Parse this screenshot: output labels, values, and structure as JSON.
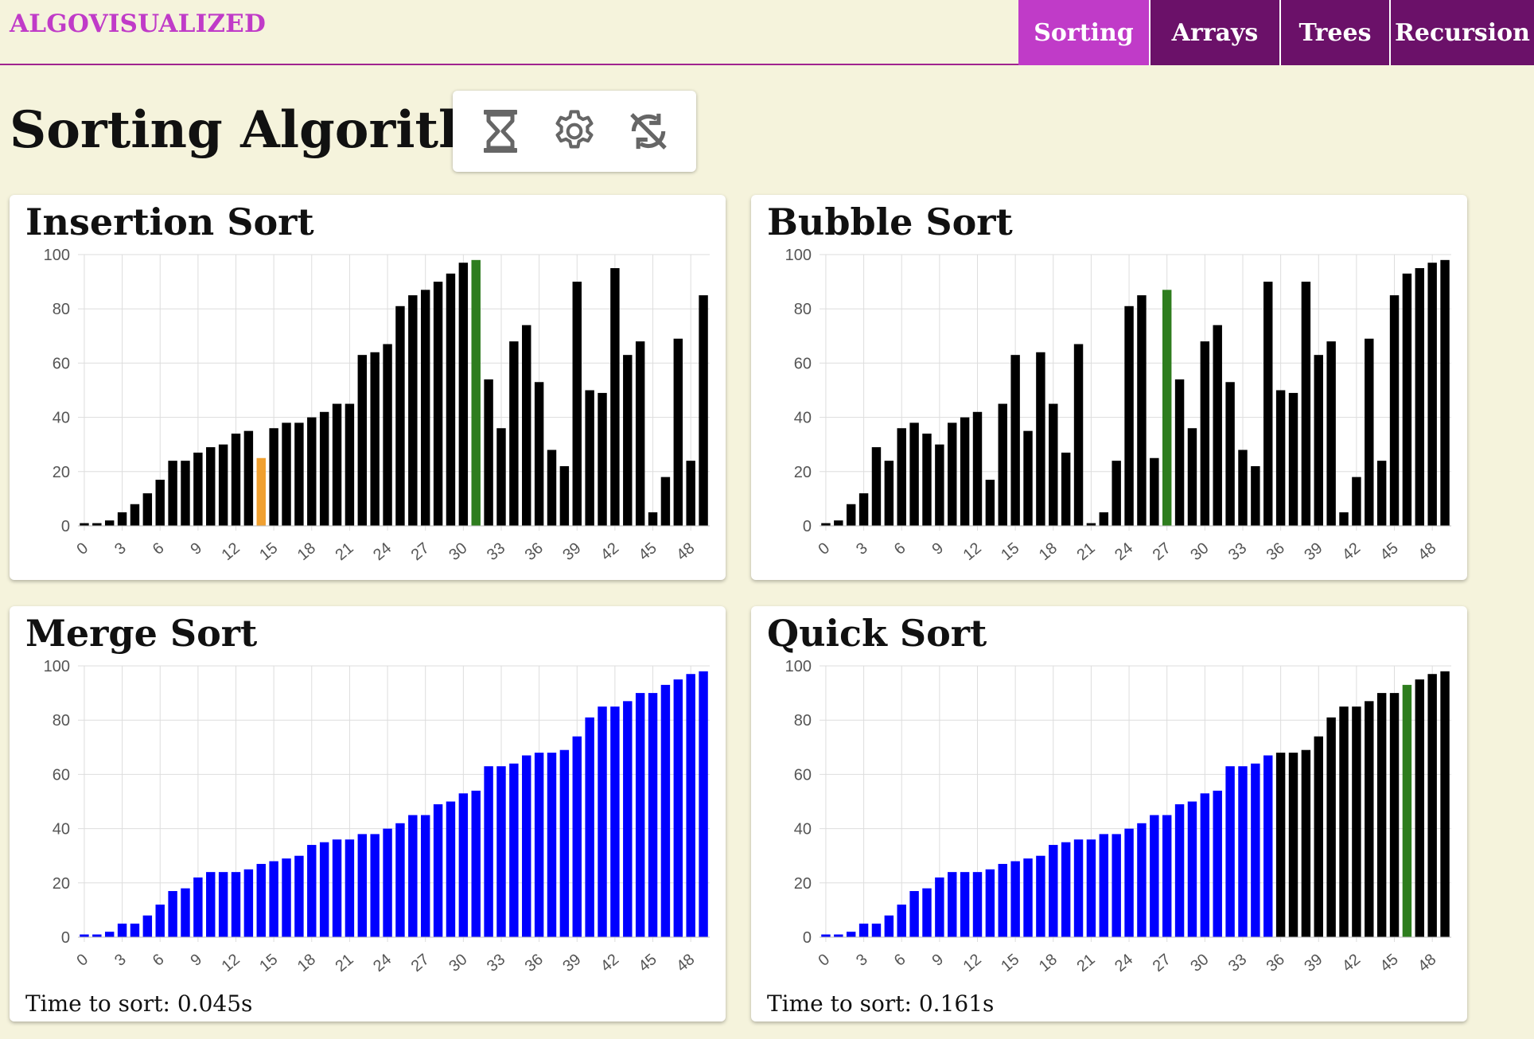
{
  "brand": "ALGOVISUALIZED",
  "nav": {
    "tabs": [
      {
        "label": "Sorting",
        "active": true
      },
      {
        "label": "Arrays",
        "active": false
      },
      {
        "label": "Trees",
        "active": false
      },
      {
        "label": "Recursion",
        "active": false
      }
    ]
  },
  "page": {
    "title": "Sorting Algorithms"
  },
  "toolbar": {
    "buttons": [
      {
        "icon": "hourglass-icon"
      },
      {
        "icon": "gear-icon"
      },
      {
        "icon": "sync-disabled-icon"
      }
    ]
  },
  "colors": {
    "default": "#000000",
    "compare": "#f0a030",
    "current": "#2e7d1e",
    "sorted": "#0000ff",
    "brand": "#c03bc8",
    "tab_active": "#c03bc8",
    "tab_inactive": "#6b1169",
    "background": "#f5f3dc"
  },
  "cards": {
    "insertion": {
      "title": "Insertion Sort"
    },
    "bubble": {
      "title": "Bubble Sort"
    },
    "merge": {
      "title": "Merge Sort",
      "footer": "Time to sort: 0.045s"
    },
    "quick": {
      "title": "Quick Sort",
      "footer": "Time to sort: 0.161s"
    }
  },
  "chart_data": [
    {
      "type": "bar",
      "title": "Insertion Sort",
      "ylim": [
        0,
        100
      ],
      "yticks": [
        0,
        20,
        40,
        60,
        80,
        100
      ],
      "xticks": [
        0,
        3,
        6,
        9,
        12,
        15,
        18,
        21,
        24,
        27,
        30,
        33,
        36,
        39,
        42,
        45,
        48
      ],
      "x": [
        0,
        1,
        2,
        3,
        4,
        5,
        6,
        7,
        8,
        9,
        10,
        11,
        12,
        13,
        14,
        15,
        16,
        17,
        18,
        19,
        20,
        21,
        22,
        23,
        24,
        25,
        26,
        27,
        28,
        29,
        30,
        31,
        32,
        33,
        34,
        35,
        36,
        37,
        38,
        39,
        40,
        41,
        42,
        43,
        44,
        45,
        46,
        47,
        48
      ],
      "values": [
        1,
        1,
        2,
        5,
        8,
        12,
        17,
        24,
        24,
        27,
        29,
        30,
        34,
        35,
        25,
        36,
        38,
        38,
        40,
        42,
        45,
        45,
        63,
        64,
        67,
        81,
        85,
        87,
        90,
        93,
        97,
        98,
        54,
        36,
        68,
        74,
        53,
        28,
        22,
        90,
        50,
        49,
        95,
        63,
        68,
        5,
        18,
        69,
        24,
        85
      ],
      "colors": [
        "default",
        "default",
        "default",
        "default",
        "default",
        "default",
        "default",
        "default",
        "default",
        "default",
        "default",
        "default",
        "default",
        "default",
        "compare",
        "default",
        "default",
        "default",
        "default",
        "default",
        "default",
        "default",
        "default",
        "default",
        "default",
        "default",
        "default",
        "default",
        "default",
        "default",
        "default",
        "current",
        "default",
        "default",
        "default",
        "default",
        "default",
        "default",
        "default",
        "default",
        "default",
        "default",
        "default",
        "default",
        "default",
        "default",
        "default",
        "default",
        "default",
        "default"
      ]
    },
    {
      "type": "bar",
      "title": "Bubble Sort",
      "ylim": [
        0,
        100
      ],
      "yticks": [
        0,
        20,
        40,
        60,
        80,
        100
      ],
      "xticks": [
        0,
        3,
        6,
        9,
        12,
        15,
        18,
        21,
        24,
        27,
        30,
        33,
        36,
        39,
        42,
        45,
        48
      ],
      "values": [
        1,
        2,
        8,
        12,
        29,
        24,
        36,
        38,
        34,
        30,
        38,
        40,
        42,
        17,
        45,
        63,
        35,
        64,
        45,
        27,
        67,
        1,
        5,
        24,
        81,
        85,
        25,
        87,
        54,
        36,
        68,
        74,
        53,
        28,
        22,
        90,
        50,
        49,
        90,
        63,
        68,
        5,
        18,
        69,
        24,
        85,
        93,
        95,
        97,
        98
      ],
      "colors": [
        "default",
        "default",
        "default",
        "default",
        "default",
        "default",
        "default",
        "default",
        "default",
        "default",
        "default",
        "default",
        "default",
        "default",
        "default",
        "default",
        "default",
        "default",
        "default",
        "default",
        "default",
        "default",
        "default",
        "default",
        "default",
        "default",
        "default",
        "current",
        "default",
        "default",
        "default",
        "default",
        "default",
        "default",
        "default",
        "default",
        "default",
        "default",
        "default",
        "default",
        "default",
        "default",
        "default",
        "default",
        "default",
        "default",
        "default",
        "default",
        "default",
        "default"
      ]
    },
    {
      "type": "bar",
      "title": "Merge Sort",
      "ylim": [
        0,
        100
      ],
      "yticks": [
        0,
        20,
        40,
        60,
        80,
        100
      ],
      "xticks": [
        0,
        3,
        6,
        9,
        12,
        15,
        18,
        21,
        24,
        27,
        30,
        33,
        36,
        39,
        42,
        45,
        48
      ],
      "values": [
        1,
        1,
        2,
        5,
        5,
        8,
        12,
        17,
        18,
        22,
        24,
        24,
        24,
        25,
        27,
        28,
        29,
        30,
        34,
        35,
        36,
        36,
        38,
        38,
        40,
        42,
        45,
        45,
        49,
        50,
        53,
        54,
        63,
        63,
        64,
        67,
        68,
        68,
        69,
        74,
        81,
        85,
        85,
        87,
        90,
        90,
        93,
        95,
        97,
        98
      ],
      "colors": [
        "sorted",
        "sorted",
        "sorted",
        "sorted",
        "sorted",
        "sorted",
        "sorted",
        "sorted",
        "sorted",
        "sorted",
        "sorted",
        "sorted",
        "sorted",
        "sorted",
        "sorted",
        "sorted",
        "sorted",
        "sorted",
        "sorted",
        "sorted",
        "sorted",
        "sorted",
        "sorted",
        "sorted",
        "sorted",
        "sorted",
        "sorted",
        "sorted",
        "sorted",
        "sorted",
        "sorted",
        "sorted",
        "sorted",
        "sorted",
        "sorted",
        "sorted",
        "sorted",
        "sorted",
        "sorted",
        "sorted",
        "sorted",
        "sorted",
        "sorted",
        "sorted",
        "sorted",
        "sorted",
        "sorted",
        "sorted",
        "sorted",
        "sorted"
      ]
    },
    {
      "type": "bar",
      "title": "Quick Sort",
      "ylim": [
        0,
        100
      ],
      "yticks": [
        0,
        20,
        40,
        60,
        80,
        100
      ],
      "xticks": [
        0,
        3,
        6,
        9,
        12,
        15,
        18,
        21,
        24,
        27,
        30,
        33,
        36,
        39,
        42,
        45,
        48
      ],
      "values": [
        1,
        1,
        2,
        5,
        5,
        8,
        12,
        17,
        18,
        22,
        24,
        24,
        24,
        25,
        27,
        28,
        29,
        30,
        34,
        35,
        36,
        36,
        38,
        38,
        40,
        42,
        45,
        45,
        49,
        50,
        53,
        54,
        63,
        63,
        64,
        67,
        68,
        68,
        69,
        74,
        81,
        85,
        85,
        87,
        90,
        90,
        93,
        95,
        97,
        98
      ],
      "colors": [
        "sorted",
        "sorted",
        "sorted",
        "sorted",
        "sorted",
        "sorted",
        "sorted",
        "sorted",
        "sorted",
        "sorted",
        "sorted",
        "sorted",
        "sorted",
        "sorted",
        "sorted",
        "sorted",
        "sorted",
        "sorted",
        "sorted",
        "sorted",
        "sorted",
        "sorted",
        "sorted",
        "sorted",
        "sorted",
        "sorted",
        "sorted",
        "sorted",
        "sorted",
        "sorted",
        "sorted",
        "sorted",
        "sorted",
        "sorted",
        "sorted",
        "sorted",
        "default",
        "default",
        "default",
        "default",
        "default",
        "default",
        "default",
        "default",
        "default",
        "default",
        "current",
        "default",
        "default",
        "default"
      ]
    }
  ]
}
